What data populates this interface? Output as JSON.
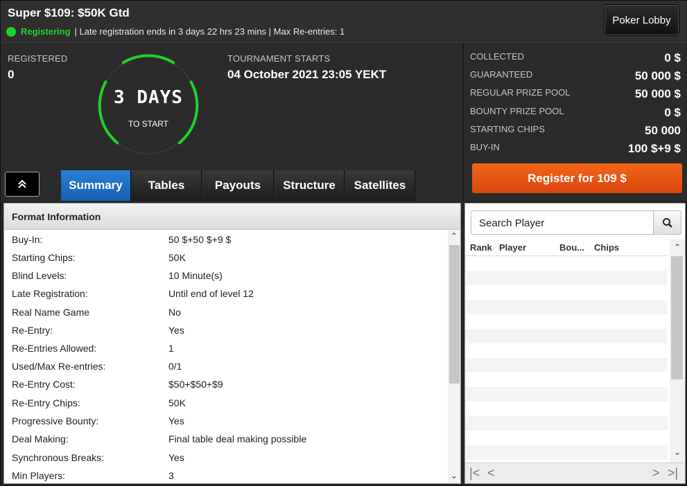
{
  "header": {
    "title": "Super $109: $50K Gtd",
    "status": "Registering",
    "status_detail": "| Late registration ends in 3 days 22 hrs  23 mins  | Max Re-entries: 1",
    "lobby_button": "Poker Lobby"
  },
  "info": {
    "registered_label": "REGISTERED",
    "registered_value": "0",
    "starts_label": "TOURNAMENT STARTS",
    "starts_value": "04 October 2021  23:05 YEKT",
    "timer_main": "3 DAYS",
    "timer_sub": "TO START"
  },
  "tabs": [
    "Summary",
    "Tables",
    "Payouts",
    "Structure",
    "Satellites"
  ],
  "active_tab": "Summary",
  "collapse_icon": "chevrons-up-icon",
  "stats": [
    {
      "label": "COLLECTED",
      "value": "0 $"
    },
    {
      "label": "GUARANTEED",
      "value": "50 000 $"
    },
    {
      "label": "REGULAR PRIZE POOL",
      "value": "50 000 $"
    },
    {
      "label": "BOUNTY PRIZE POOL",
      "value": "0 $"
    },
    {
      "label": "STARTING CHIPS",
      "value": "50 000"
    },
    {
      "label": "BUY-IN",
      "value": "100 $+9 $"
    }
  ],
  "register_button": "Register for  109 $",
  "format": {
    "header": "Format Information",
    "rows": [
      {
        "k": "Buy-In:",
        "v": "50 $+50 $+9 $"
      },
      {
        "k": "Starting Chips:",
        "v": "50K"
      },
      {
        "k": "Blind Levels:",
        "v": "10 Minute(s)"
      },
      {
        "k": "Late Registration:",
        "v": "Until end of level 12"
      },
      {
        "k": "Real Name Game",
        "v": "No"
      },
      {
        "k": "Re-Entry:",
        "v": "Yes"
      },
      {
        "k": "Re-Entries Allowed:",
        "v": "1"
      },
      {
        "k": "Used/Max Re-entries:",
        "v": "0/1"
      },
      {
        "k": "Re-Entry Cost:",
        "v": "$50+$50+$9"
      },
      {
        "k": "Re-Entry Chips:",
        "v": "50K"
      },
      {
        "k": "Progressive Bounty:",
        "v": "Yes"
      },
      {
        "k": "Deal Making:",
        "v": "Final table deal making possible"
      },
      {
        "k": "Synchronous Breaks:",
        "v": "Yes"
      },
      {
        "k": "Min Players:",
        "v": "3"
      }
    ]
  },
  "players": {
    "search_placeholder": "Search Player",
    "columns": [
      "Rank",
      "Player",
      "Bou...",
      "Chips"
    ],
    "pager_first": "|<",
    "pager_prev": "<",
    "pager_next": ">",
    "pager_last": ">|"
  },
  "colors": {
    "accent_green": "#22d22e",
    "tab_active": "#1f6fc6",
    "register": "#e8531a"
  }
}
